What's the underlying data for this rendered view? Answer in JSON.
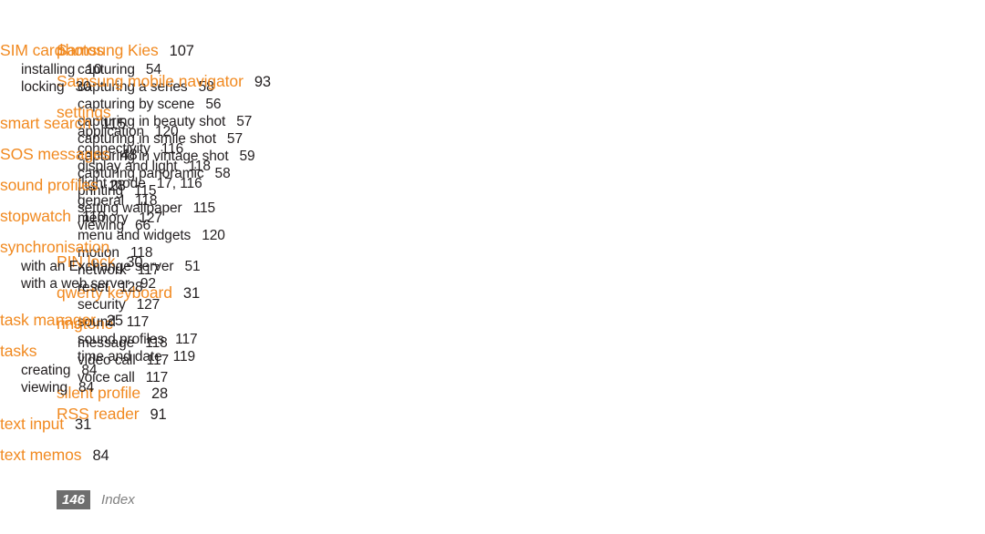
{
  "document": {
    "type": "index-page",
    "accent_color": "#f18a21",
    "text_color": "#231f20",
    "footer_box_color": "#6e6e6e",
    "footer_label_color": "#808080",
    "background_color": "#ffffff"
  },
  "footer": {
    "page_number": "146",
    "section_label": "Index"
  },
  "columns": [
    {
      "id": "column-1",
      "groups": [
        {
          "heading": "photos",
          "heading_page": "",
          "subentries": [
            {
              "label": "capturing",
              "page": "54"
            },
            {
              "label": "capturing a series",
              "page": "58"
            },
            {
              "label": "capturing by scene",
              "page": "56"
            },
            {
              "label": "capturing in beauty shot",
              "page": "57"
            },
            {
              "label": "capturing in smile shot",
              "page": "57"
            },
            {
              "label": "capturing in vintage shot",
              "page": "59"
            },
            {
              "label": "capturing panoramic",
              "page": "58"
            },
            {
              "label": "printing",
              "page": "115"
            },
            {
              "label": "setting wallpaper",
              "page": "115"
            },
            {
              "label": "viewing",
              "page": "66"
            }
          ]
        },
        {
          "heading": "PIN lock",
          "heading_page": "30",
          "subentries": []
        },
        {
          "heading": "qwerty keyboard",
          "heading_page": "31",
          "subentries": []
        },
        {
          "heading": "ringtone",
          "heading_page": "",
          "subentries": [
            {
              "label": "message",
              "page": "118"
            },
            {
              "label": "video call",
              "page": "117"
            },
            {
              "label": "voice call",
              "page": "117"
            }
          ]
        },
        {
          "heading": "RSS reader",
          "heading_page": "91",
          "subentries": []
        }
      ]
    },
    {
      "id": "column-2",
      "groups": [
        {
          "heading": "Samsung Kies",
          "heading_page": "107",
          "subentries": []
        },
        {
          "heading": "Samsung mobile navigator",
          "heading_page": "93",
          "subentries": []
        },
        {
          "heading": "settings",
          "heading_page": "",
          "subentries": [
            {
              "label": "application",
              "page": "120"
            },
            {
              "label": "connectivity",
              "page": "116"
            },
            {
              "label": "display and light",
              "page": "118"
            },
            {
              "label": "flight mode",
              "page": "17, 116"
            },
            {
              "label": "general",
              "page": "118"
            },
            {
              "label": "memory",
              "page": "127"
            },
            {
              "label": "menu and widgets",
              "page": "120"
            },
            {
              "label": "motion",
              "page": "118"
            },
            {
              "label": "network",
              "page": "117"
            },
            {
              "label": "reset",
              "page": "128"
            },
            {
              "label": "security",
              "page": "127"
            },
            {
              "label": "sound",
              "page": "117"
            },
            {
              "label": "sound profiles",
              "page": "117"
            },
            {
              "label": "time and date",
              "page": "119"
            }
          ]
        },
        {
          "heading": "silent profile",
          "heading_page": "28",
          "subentries": []
        }
      ]
    },
    {
      "id": "column-3",
      "groups": [
        {
          "heading": "SIM card",
          "heading_page": "",
          "subentries": [
            {
              "label": "installing",
              "page": "10"
            },
            {
              "label": "locking",
              "page": "30"
            }
          ]
        },
        {
          "heading": "smart search",
          "heading_page": "115",
          "subentries": []
        },
        {
          "heading": "SOS messages",
          "heading_page": "48",
          "subentries": []
        },
        {
          "heading": "sound profiles",
          "heading_page": "28",
          "subentries": []
        },
        {
          "heading": "stopwatch",
          "heading_page": "110",
          "subentries": []
        },
        {
          "heading": "synchronisation",
          "heading_page": "",
          "subentries": [
            {
              "label": "with an Exchange server",
              "page": "51"
            },
            {
              "label": "with a web server",
              "page": "92"
            }
          ]
        },
        {
          "heading": "task manager",
          "heading_page": "25",
          "subentries": []
        },
        {
          "heading": "tasks",
          "heading_page": "",
          "subentries": [
            {
              "label": "creating",
              "page": "84"
            },
            {
              "label": "viewing",
              "page": "84"
            }
          ]
        },
        {
          "heading": "text input",
          "heading_page": "31",
          "subentries": []
        },
        {
          "heading": "text memos",
          "heading_page": "84",
          "subentries": []
        }
      ]
    }
  ]
}
